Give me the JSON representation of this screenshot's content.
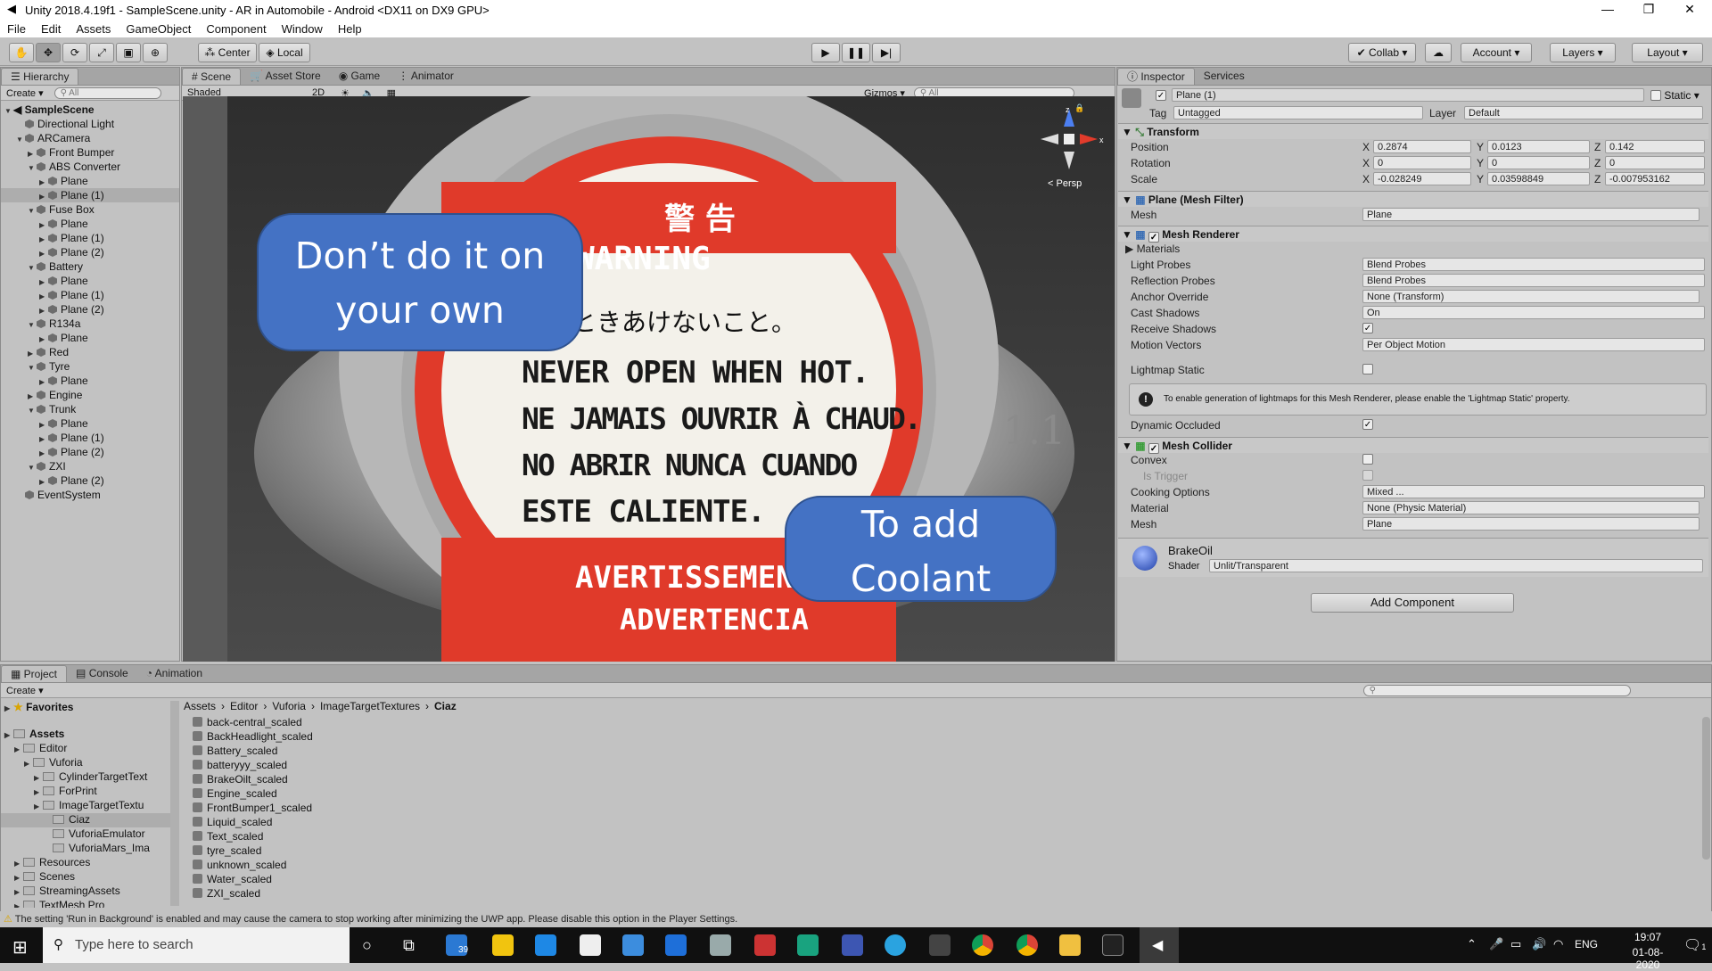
{
  "window": {
    "title": "Unity 2018.4.19f1 - SampleScene.unity - AR in Automobile - Android <DX11 on DX9 GPU>"
  },
  "menu": [
    "File",
    "Edit",
    "Assets",
    "GameObject",
    "Component",
    "Window",
    "Help"
  ],
  "toolbar": {
    "center": "Center",
    "local": "Local",
    "collab": "Collab",
    "account": "Account",
    "layers": "Layers",
    "layout": "Layout"
  },
  "hierarchy": {
    "tab": "Hierarchy",
    "create": "Create",
    "search": "All",
    "scene": "SampleScene",
    "items": [
      {
        "label": "Directional Light",
        "depth": 1,
        "tri": ""
      },
      {
        "label": "ARCamera",
        "depth": 1,
        "tri": "▼"
      },
      {
        "label": "Front Bumper",
        "depth": 2,
        "tri": "▶"
      },
      {
        "label": "ABS Converter",
        "depth": 2,
        "tri": "▼"
      },
      {
        "label": "Plane",
        "depth": 3,
        "tri": "▶"
      },
      {
        "label": "Plane (1)",
        "depth": 3,
        "tri": "▶",
        "sel": true
      },
      {
        "label": "Fuse Box",
        "depth": 2,
        "tri": "▼"
      },
      {
        "label": "Plane",
        "depth": 3,
        "tri": "▶"
      },
      {
        "label": "Plane (1)",
        "depth": 3,
        "tri": "▶"
      },
      {
        "label": "Plane (2)",
        "depth": 3,
        "tri": "▶"
      },
      {
        "label": "Battery",
        "depth": 2,
        "tri": "▼"
      },
      {
        "label": "Plane",
        "depth": 3,
        "tri": "▶"
      },
      {
        "label": "Plane (1)",
        "depth": 3,
        "tri": "▶"
      },
      {
        "label": "Plane (2)",
        "depth": 3,
        "tri": "▶"
      },
      {
        "label": "R134a",
        "depth": 2,
        "tri": "▼"
      },
      {
        "label": "Plane",
        "depth": 3,
        "tri": "▶"
      },
      {
        "label": "Red",
        "depth": 2,
        "tri": "▶"
      },
      {
        "label": "Tyre",
        "depth": 2,
        "tri": "▼"
      },
      {
        "label": "Plane",
        "depth": 3,
        "tri": "▶"
      },
      {
        "label": "Engine",
        "depth": 2,
        "tri": "▶"
      },
      {
        "label": "Trunk",
        "depth": 2,
        "tri": "▼"
      },
      {
        "label": "Plane",
        "depth": 3,
        "tri": "▶"
      },
      {
        "label": "Plane (1)",
        "depth": 3,
        "tri": "▶"
      },
      {
        "label": "Plane (2)",
        "depth": 3,
        "tri": "▶"
      },
      {
        "label": "ZXI",
        "depth": 2,
        "tri": "▼"
      },
      {
        "label": "Plane (2)",
        "depth": 3,
        "tri": "▶"
      },
      {
        "label": "EventSystem",
        "depth": 1,
        "tri": ""
      }
    ]
  },
  "sceneview": {
    "tabs": [
      "Scene",
      "Asset Store",
      "Game",
      "Animator"
    ],
    "shaded": "Shaded",
    "mode2d": "2D",
    "gizmos": "Gizmos",
    "search": "All",
    "persp": "Persp",
    "bubble1": "Don’t do it on your own",
    "bubble2": "To add Coolant",
    "cap": {
      "kanji": "警 告",
      "warning": "WARNING",
      "jp": "熱いときあけないこと。",
      "line1": "NEVER OPEN WHEN HOT.",
      "line2": "NE JAMAIS OUVRIR À CHAUD.",
      "line3": "NO ABRIR NUNCA CUANDO",
      "line4": "ESTE CALIENTE.",
      "avert": "AVERTISSEMENT",
      "advert": "ADVERTENCIA",
      "rating": "1.1"
    }
  },
  "inspector": {
    "tabs": [
      "Inspector",
      "Services"
    ],
    "name": "Plane (1)",
    "static": "Static",
    "tag_label": "Tag",
    "tag": "Untagged",
    "layer_label": "Layer",
    "layer": "Default",
    "transform": {
      "title": "Transform",
      "position": {
        "label": "Position",
        "x": "0.2874",
        "y": "0.0123",
        "z": "0.142"
      },
      "rotation": {
        "label": "Rotation",
        "x": "0",
        "y": "0",
        "z": "0"
      },
      "scale": {
        "label": "Scale",
        "x": "-0.028249",
        "y": "0.03598849",
        "z": "-0.007953162"
      }
    },
    "mesh_filter": {
      "title": "Plane (Mesh Filter)",
      "mesh_label": "Mesh",
      "mesh": "Plane"
    },
    "mesh_renderer": {
      "title": "Mesh Renderer",
      "materials": "Materials",
      "light_probes_label": "Light Probes",
      "light_probes": "Blend Probes",
      "reflection_label": "Reflection Probes",
      "reflection": "Blend Probes",
      "anchor_label": "Anchor Override",
      "anchor": "None (Transform)",
      "cast_label": "Cast Shadows",
      "cast": "On",
      "receive_label": "Receive Shadows",
      "motion_label": "Motion Vectors",
      "motion": "Per Object Motion",
      "lightmap_label": "Lightmap Static",
      "info": "To enable generation of lightmaps for this Mesh Renderer, please enable the 'Lightmap Static' property.",
      "dynamic_label": "Dynamic Occluded"
    },
    "mesh_collider": {
      "title": "Mesh Collider",
      "convex": "Convex",
      "trigger": "Is Trigger",
      "cooking_label": "Cooking Options",
      "cooking": "Mixed ...",
      "material_label": "Material",
      "material": "None (Physic Material)",
      "mesh_label": "Mesh",
      "mesh": "Plane"
    },
    "material": {
      "name": "BrakeOil",
      "shader_label": "Shader",
      "shader": "Unlit/Transparent"
    },
    "add_component": "Add Component"
  },
  "project": {
    "tabs": [
      "Project",
      "Console",
      "Animation"
    ],
    "create": "Create",
    "favorites": "Favorites",
    "tree": [
      {
        "label": "Assets",
        "depth": 0,
        "bold": true
      },
      {
        "label": "Editor",
        "depth": 1
      },
      {
        "label": "Vuforia",
        "depth": 2
      },
      {
        "label": "CylinderTargetText",
        "depth": 3
      },
      {
        "label": "ForPrint",
        "depth": 3
      },
      {
        "label": "ImageTargetTextu",
        "depth": 3
      },
      {
        "label": "Ciaz",
        "depth": 4,
        "sel": true
      },
      {
        "label": "VuforiaEmulator",
        "depth": 4
      },
      {
        "label": "VuforiaMars_Ima",
        "depth": 4
      },
      {
        "label": "Resources",
        "depth": 1
      },
      {
        "label": "Scenes",
        "depth": 1
      },
      {
        "label": "StreamingAssets",
        "depth": 1
      },
      {
        "label": "TextMesh Pro",
        "depth": 1
      }
    ],
    "breadcrumb": [
      "Assets",
      "Editor",
      "Vuforia",
      "ImageTargetTextures",
      "Ciaz"
    ],
    "files": [
      "back-central_scaled",
      "BackHeadlight_scaled",
      "Battery_scaled",
      "batteryyy_scaled",
      "BrakeOilt_scaled",
      "Engine_scaled",
      "FrontBumper1_scaled",
      "Liquid_scaled",
      "Text_scaled",
      "tyre_scaled",
      "unknown_scaled",
      "Water_scaled",
      "ZXI_scaled"
    ]
  },
  "status": "The setting 'Run in Background' is enabled and may cause the camera to stop working after minimizing the UWP app. Please disable this option in the Player Settings.",
  "taskbar": {
    "search": "Type here to search",
    "mail_badge": "39",
    "lang": "ENG",
    "time": "19:07",
    "date": "01-08-2020",
    "notif": "1"
  }
}
